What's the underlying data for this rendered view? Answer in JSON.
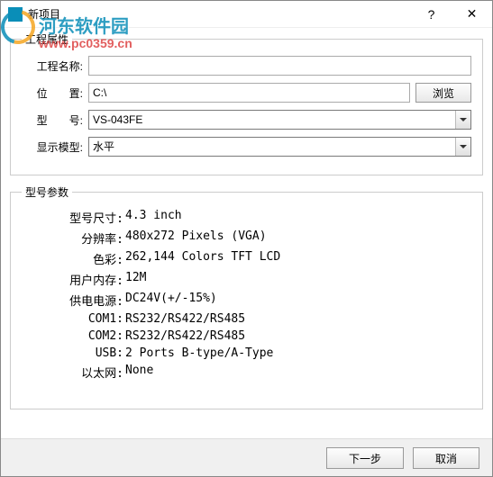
{
  "window": {
    "title": "新项目"
  },
  "watermark": {
    "site_name": "河东软件园",
    "site_url": "www.pc0359.cn"
  },
  "groups": {
    "project_props": "工程属性",
    "model_params": "型号参数"
  },
  "form": {
    "project_name_label": "工程名称:",
    "project_name_value": "",
    "location_label": "位　　置:",
    "location_value": "C:\\",
    "browse_btn": "浏览",
    "model_label": "型　　号:",
    "model_value": "VS-043FE",
    "display_model_label": "显示模型:",
    "display_model_value": "水平"
  },
  "specs": {
    "size_label": "型号尺寸:",
    "size_value": "4.3 inch",
    "resolution_label": "分辨率:",
    "resolution_value": "480x272 Pixels (VGA)",
    "color_label": "色彩:",
    "color_value": "262,144 Colors TFT LCD",
    "memory_label": "用户内存:",
    "memory_value": "12M",
    "power_label": "供电电源:",
    "power_value": "DC24V(+/-15%)",
    "com1_label": "COM1:",
    "com1_value": "RS232/RS422/RS485",
    "com2_label": "COM2:",
    "com2_value": "RS232/RS422/RS485",
    "usb_label": "USB:",
    "usb_value": "2 Ports B-type/A-Type",
    "ethernet_label": "以太网:",
    "ethernet_value": "None"
  },
  "footer": {
    "next": "下一步",
    "cancel": "取消"
  }
}
